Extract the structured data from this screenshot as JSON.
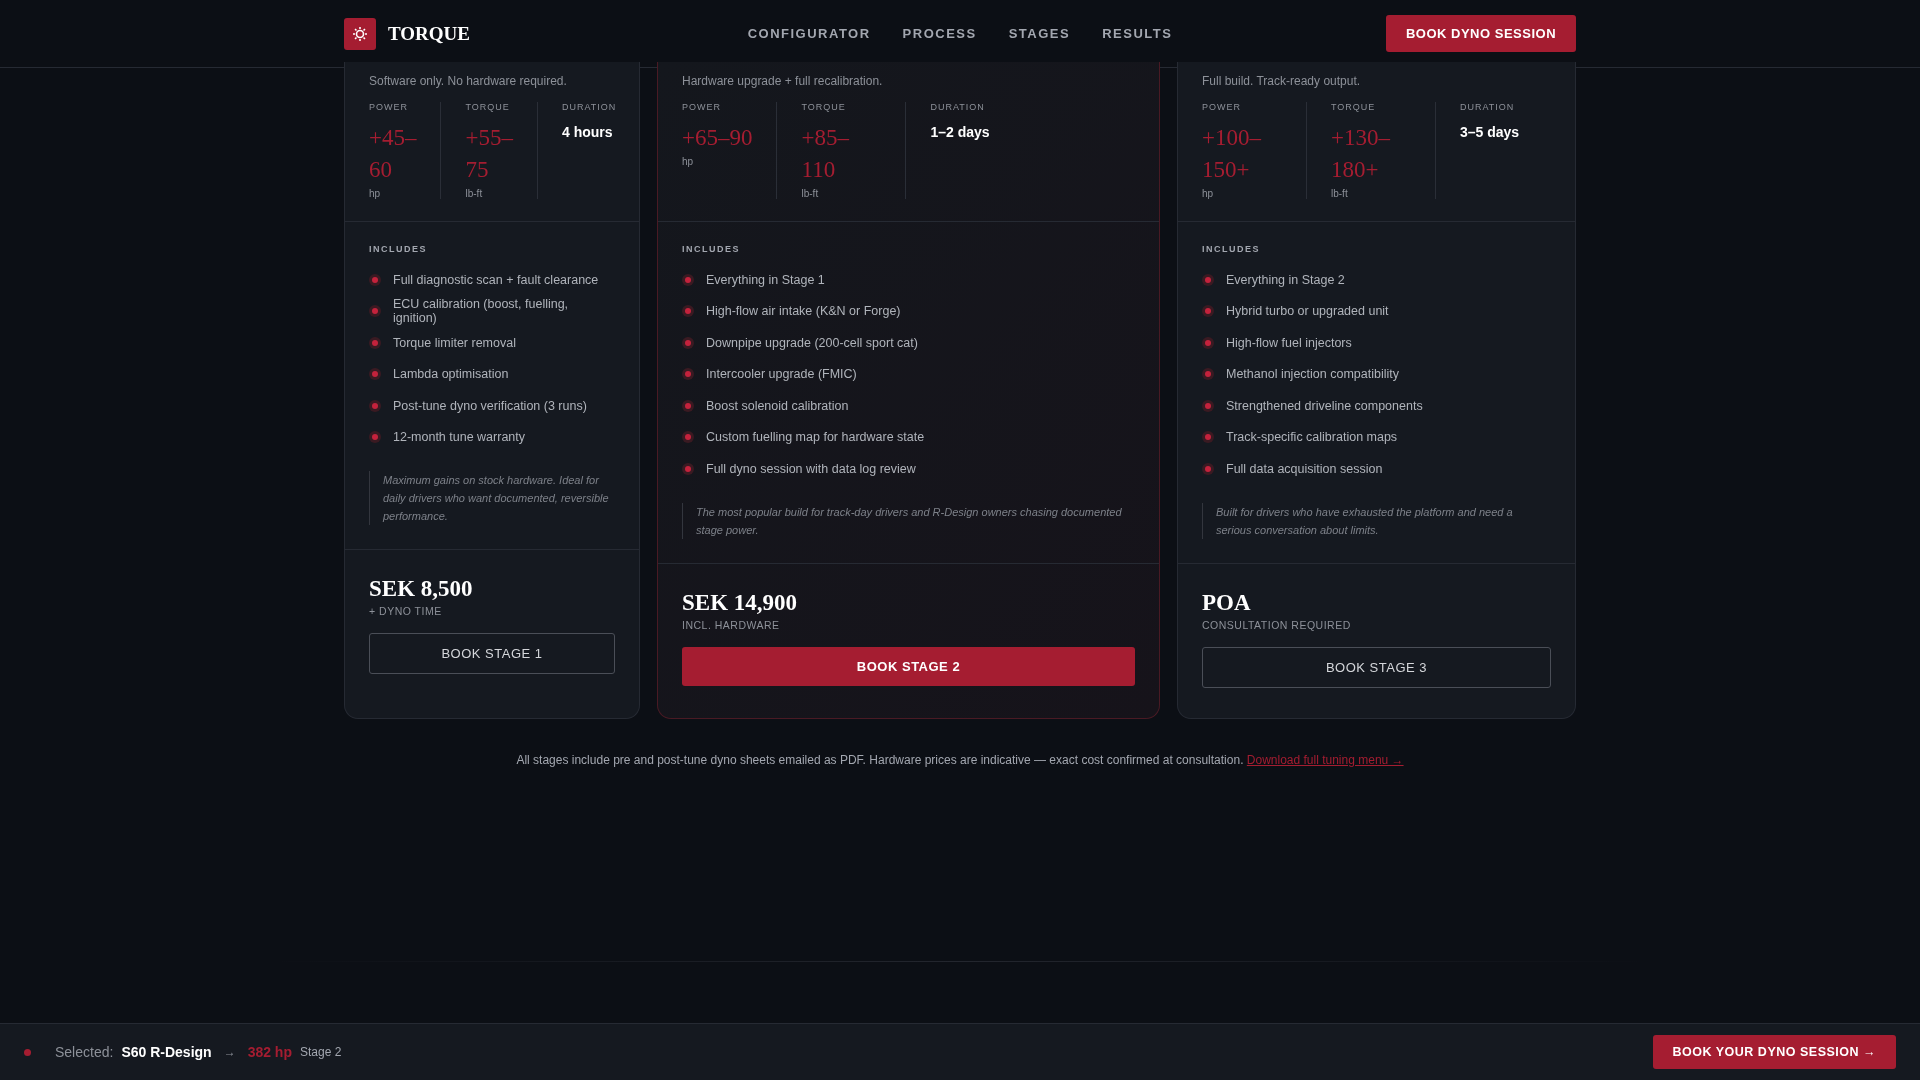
{
  "header": {
    "brand": "TORQUE",
    "nav": [
      "CONFIGURATOR",
      "PROCESS",
      "STAGES",
      "RESULTS"
    ],
    "cta": "BOOK DYNO SESSION"
  },
  "stages": [
    {
      "subtitle": "Software only. No hardware required.",
      "featured": false,
      "stats": [
        {
          "label": "POWER",
          "value": "+45–60",
          "unit": "hp",
          "kind": "metric"
        },
        {
          "label": "TORQUE",
          "value": "+55–75",
          "unit": "lb-ft",
          "kind": "metric"
        },
        {
          "label": "DURATION",
          "value": "4 hours",
          "kind": "duration"
        }
      ],
      "includes_label": "INCLUDES",
      "includes": [
        "Full diagnostic scan + fault clearance",
        "ECU calibration (boost, fuelling, ignition)",
        "Torque limiter removal",
        "Lambda optimisation",
        "Post-tune dyno verification (3 runs)",
        "12-month tune warranty"
      ],
      "note": "Maximum gains on stock hardware. Ideal for daily drivers who want documented, reversible performance.",
      "price": "SEK 8,500",
      "price_note": "+ DYNO TIME",
      "button": "BOOK STAGE 1"
    },
    {
      "subtitle": "Hardware upgrade + full recalibration.",
      "featured": true,
      "stats": [
        {
          "label": "POWER",
          "value": "+65–90",
          "unit": "hp",
          "kind": "metric"
        },
        {
          "label": "TORQUE",
          "value": "+85–110",
          "unit": "lb-ft",
          "kind": "metric"
        },
        {
          "label": "DURATION",
          "value": "1–2 days",
          "kind": "duration"
        }
      ],
      "includes_label": "INCLUDES",
      "includes": [
        "Everything in Stage 1",
        "High-flow air intake (K&N or Forge)",
        "Downpipe upgrade (200-cell sport cat)",
        "Intercooler upgrade (FMIC)",
        "Boost solenoid calibration",
        "Custom fuelling map for hardware state",
        "Full dyno session with data log review"
      ],
      "note": "The most popular build for track-day drivers and R-Design owners chasing documented stage power.",
      "price": "SEK 14,900",
      "price_note": "INCL. HARDWARE",
      "button": "BOOK STAGE 2"
    },
    {
      "subtitle": "Full build. Track-ready output.",
      "featured": false,
      "stats": [
        {
          "label": "POWER",
          "value": "+100–150+",
          "unit": "hp",
          "kind": "metric"
        },
        {
          "label": "TORQUE",
          "value": "+130–180+",
          "unit": "lb-ft",
          "kind": "metric"
        },
        {
          "label": "DURATION",
          "value": "3–5 days",
          "kind": "duration"
        }
      ],
      "includes_label": "INCLUDES",
      "includes": [
        "Everything in Stage 2",
        "Hybrid turbo or upgraded unit",
        "High-flow fuel injectors",
        "Methanol injection compatibility",
        "Strengthened driveline components",
        "Track-specific calibration maps",
        "Full data acquisition session"
      ],
      "note": "Built for drivers who have exhausted the platform and need a serious conversation about limits.",
      "price": "POA",
      "price_note": "CONSULTATION REQUIRED",
      "button": "BOOK STAGE 3"
    }
  ],
  "footnote": {
    "text": "All stages include pre and post-tune dyno sheets emailed as PDF. Hardware prices are indicative — exact cost confirmed at consultation.",
    "link": "Download full tuning menu →"
  },
  "selection_bar": {
    "label": "Selected:",
    "model": "S60 R-Design",
    "arrow": "→",
    "power": "382 hp",
    "stage": "Stage 2",
    "cta": "BOOK YOUR DYNO SESSION →"
  }
}
